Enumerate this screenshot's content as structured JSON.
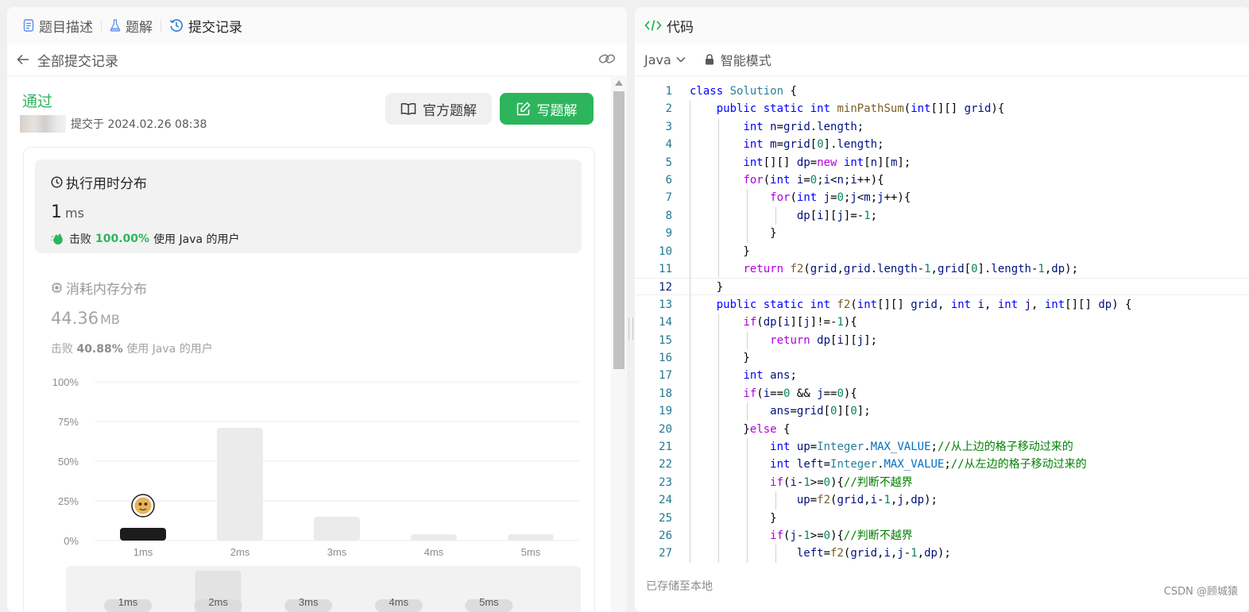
{
  "left_tabs": [
    {
      "label": "题目描述",
      "icon": "document-icon"
    },
    {
      "label": "题解",
      "icon": "flask-icon"
    },
    {
      "label": "提交记录",
      "icon": "history-icon"
    }
  ],
  "subheader": {
    "title": "全部提交记录"
  },
  "submission": {
    "status": "通过",
    "submitted_at": "提交于 2024.02.26 08:38",
    "btn_official": "官方题解",
    "btn_write": "写题解"
  },
  "runtime": {
    "title": "执行用时分布",
    "value": "1",
    "unit": "ms",
    "beat_prefix": "击败",
    "beat_pct": "100.00%",
    "beat_suffix": "使用 Java 的用户"
  },
  "memory": {
    "title": "消耗内存分布",
    "value": "44.36",
    "unit": "MB",
    "beat_prefix": "击败",
    "beat_pct": "40.88%",
    "beat_suffix": "使用 Java 的用户"
  },
  "chart_data": {
    "type": "bar",
    "categories": [
      "1ms",
      "2ms",
      "3ms",
      "4ms",
      "5ms"
    ],
    "values": [
      8,
      71,
      15,
      4,
      4
    ],
    "highlight_index": 0,
    "ylim": [
      0,
      100
    ],
    "yticks": [
      "100%",
      "75%",
      "50%",
      "25%",
      "0%"
    ],
    "ytick_values": [
      100,
      75,
      50,
      25,
      0
    ],
    "grid": true,
    "colors": {
      "highlight": "#1c1c1c",
      "bar": "#ebebeb",
      "grid": "#ececec"
    }
  },
  "minimap": {
    "labels": [
      "1ms",
      "2ms",
      "3ms",
      "4ms",
      "5ms"
    ],
    "highlight_index": 1
  },
  "code_panel": {
    "title": "代码",
    "language": "Java",
    "mode": "智能模式",
    "saved": "已存储至本地",
    "current_line": 12
  },
  "code_lines": [
    "class Solution {",
    "    public static int minPathSum(int[][] grid){",
    "        int n=grid.length;",
    "        int m=grid[0].length;",
    "        int[][] dp=new int[n][m];",
    "        for(int i=0;i<n;i++){",
    "            for(int j=0;j<m;j++){",
    "                dp[i][j]=-1;",
    "            }",
    "        }",
    "        return f2(grid,grid.length-1,grid[0].length-1,dp);",
    "    }",
    "    public static int f2(int[][] grid, int i, int j, int[][] dp) {",
    "        if(dp[i][j]!=-1){",
    "            return dp[i][j];",
    "        }",
    "        int ans;",
    "        if(i==0 && j==0){",
    "            ans=grid[0][0];",
    "        }else {",
    "            int up=Integer.MAX_VALUE;//从上边的格子移动过来的",
    "            int left=Integer.MAX_VALUE;//从左边的格子移动过来的",
    "            if(i-1>=0){//判断不越界",
    "                up=f2(grid,i-1,j,dp);",
    "            }",
    "            if(j-1>=0){//判断不越界",
    "                left=f2(grid,i,j-1,dp);"
  ],
  "watermark": "CSDN @顾城猿",
  "colors": {
    "accent": "#2db55d",
    "link_blue": "#007aff"
  }
}
